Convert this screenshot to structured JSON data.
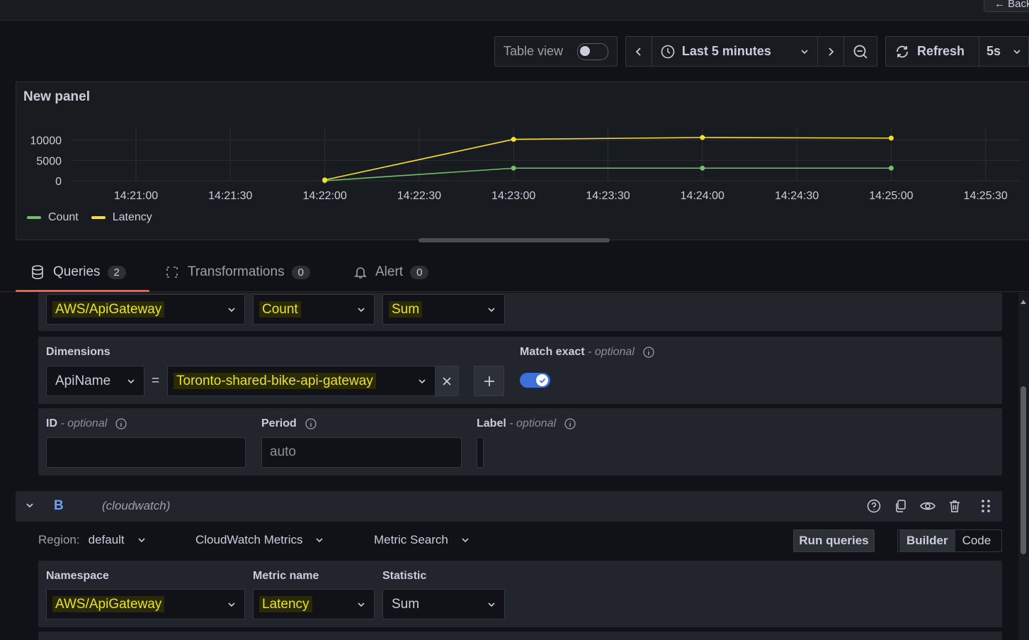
{
  "topbar": {
    "back_label": "← Back"
  },
  "toolbar": {
    "table_view_label": "Table view",
    "table_view_on": false,
    "time_range": "Last 5 minutes",
    "refresh_label": "Refresh",
    "refresh_interval": "5s"
  },
  "panel": {
    "title": "New panel",
    "chart_data": {
      "type": "line",
      "x": [
        "14:22:00",
        "14:23:00",
        "14:24:00",
        "14:25:00"
      ],
      "x_ticks": [
        "14:21:00",
        "14:21:30",
        "14:22:00",
        "14:22:30",
        "14:23:00",
        "14:23:30",
        "14:24:00",
        "14:24:30",
        "14:25:00",
        "14:25:30"
      ],
      "y_ticks": [
        "10000",
        "5000",
        "0"
      ],
      "ylim": [
        0,
        11000
      ],
      "series": [
        {
          "name": "Count",
          "color": "#73bf69",
          "values": [
            0,
            3100,
            3100,
            3100
          ]
        },
        {
          "name": "Latency",
          "color": "#fade2a",
          "values": [
            200,
            10200,
            10650,
            10500
          ]
        }
      ],
      "legend": "bottom-left",
      "grid": true
    }
  },
  "tabs": [
    {
      "label": "Queries",
      "count": "2",
      "icon": "database-icon"
    },
    {
      "label": "Transformations",
      "count": "0",
      "icon": "transform-icon"
    },
    {
      "label": "Alert",
      "count": "0",
      "icon": "bell-icon"
    }
  ],
  "queryA": {
    "namespace": "AWS/ApiGateway",
    "metric": "Count",
    "statistic": "Sum",
    "dimensions_label": "Dimensions",
    "dimension_key": "ApiName",
    "dimension_op": "=",
    "dimension_value": "Toronto-shared-bike-api-gateway",
    "match_exact_label": "Match exact",
    "optional": "- optional",
    "match_exact_on": true,
    "id_label": "ID",
    "id_value": "",
    "period_label": "Period",
    "period_placeholder": "auto",
    "label_label": "Label",
    "label_value": ""
  },
  "queryB": {
    "ref": "B",
    "datasource": "(cloudwatch)",
    "region_label": "Region:",
    "region_value": "default",
    "service": "CloudWatch Metrics",
    "mode": "Metric Search",
    "run_label": "Run queries",
    "builder_label": "Builder",
    "code_label": "Code",
    "namespace_label": "Namespace",
    "metric_label": "Metric name",
    "statistic_label": "Statistic",
    "namespace": "AWS/ApiGateway",
    "metric": "Latency",
    "statistic": "Sum"
  }
}
